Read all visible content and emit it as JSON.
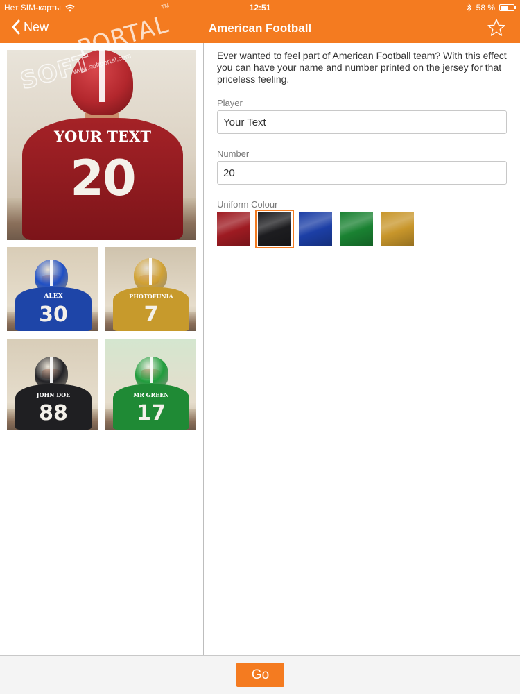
{
  "status_bar": {
    "carrier": "Нет SIM-карты",
    "time": "12:51",
    "battery_text": "58 %",
    "battery_level": 0.58
  },
  "nav": {
    "back_label": "New",
    "title": "American Football",
    "back_icon": "chevron-left-icon",
    "favorite_icon": "star-icon"
  },
  "watermark": {
    "soft": "SOFT",
    "portal": "PORTAL",
    "url": "www.softportal.com",
    "tm": "TM"
  },
  "gallery": {
    "main": {
      "name": "YOUR TEXT",
      "number": "20",
      "jersey_color": "#a52227",
      "helmet_color": "#b3272d"
    },
    "examples": [
      {
        "name": "ALEX",
        "number": "30",
        "jersey_color": "#1e45a8",
        "helmet_color": "#1f4fc4",
        "bg": "#d9cdb7"
      },
      {
        "name": "PHOTOFUNIA",
        "number": "7",
        "jersey_color": "#c79a2c",
        "helmet_color": "#d1a235",
        "bg": "#cfc3ad"
      },
      {
        "name": "JOHN DOE",
        "number": "88",
        "jersey_color": "#1f1f22",
        "helmet_color": "#222226",
        "bg": "#d8cdb8"
      },
      {
        "name": "MR GREEN",
        "number": "17",
        "jersey_color": "#1f8a35",
        "helmet_color": "#209c3c",
        "bg": "#d4e6cf"
      }
    ]
  },
  "form": {
    "description": "Ever wanted to feel part of American Football team? With this effect you can have your name and number printed on the jersey for that priceless feeling.",
    "player_label": "Player",
    "player_value": "Your Text",
    "number_label": "Number",
    "number_value": "20",
    "uniform_label": "Uniform Colour",
    "colours": [
      {
        "name": "red",
        "hex": "#9e1b22",
        "selected": false
      },
      {
        "name": "black",
        "hex": "#1d1d20",
        "selected": true
      },
      {
        "name": "blue",
        "hex": "#1c3fa6",
        "selected": false
      },
      {
        "name": "green",
        "hex": "#1a8232",
        "selected": false
      },
      {
        "name": "gold",
        "hex": "#c8962b",
        "selected": false
      }
    ]
  },
  "footer": {
    "go_label": "Go"
  },
  "colors": {
    "accent": "#f47b20",
    "divider": "#bdbdbd"
  }
}
